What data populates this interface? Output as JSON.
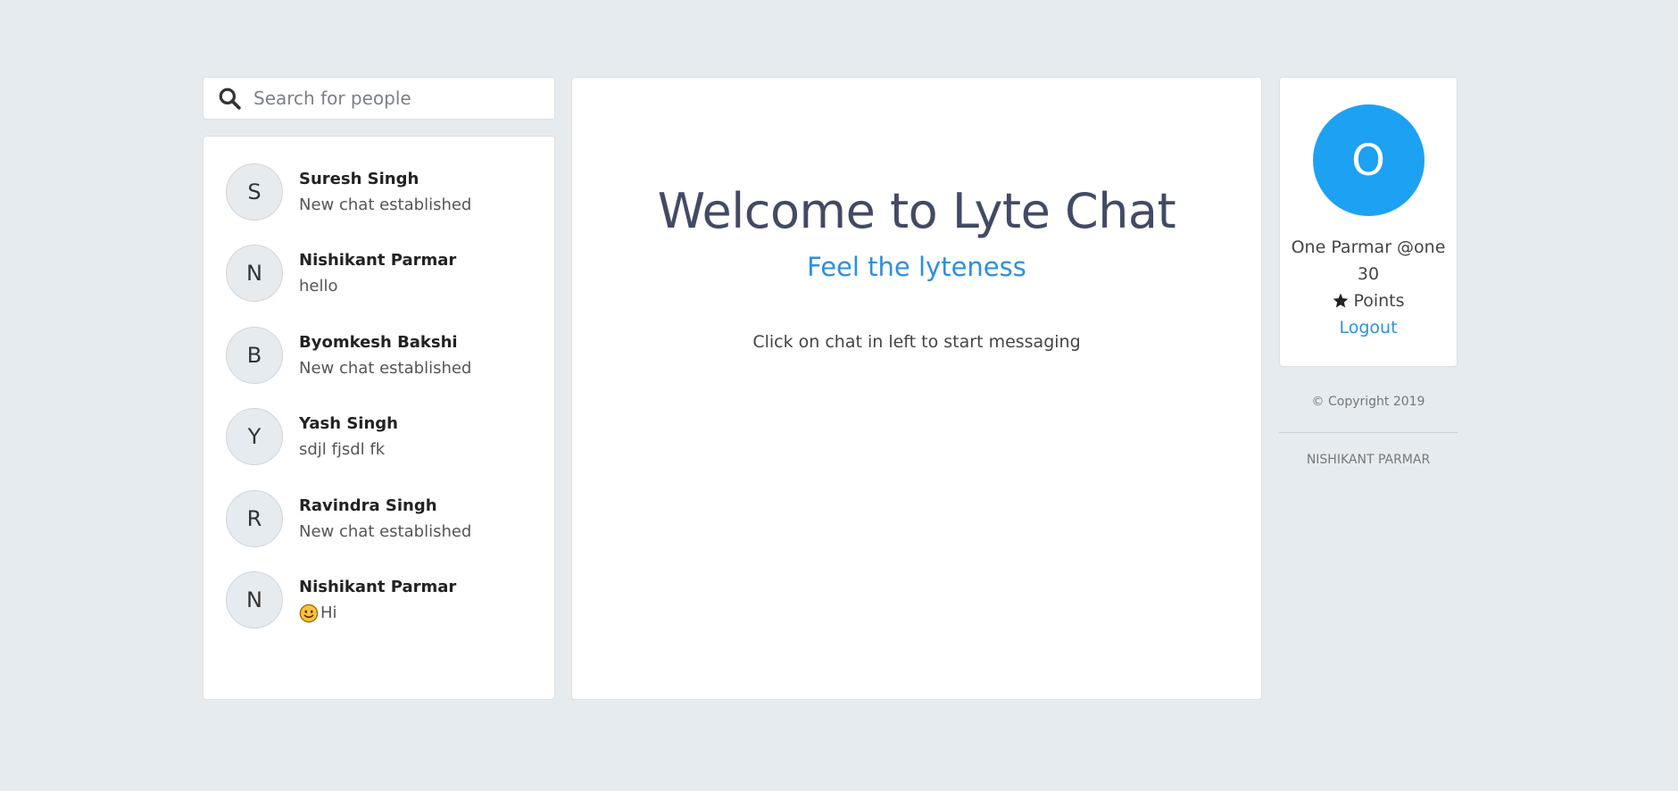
{
  "search": {
    "placeholder": "Search for people"
  },
  "chats": [
    {
      "initial": "S",
      "name": "Suresh Singh",
      "message": "New chat established",
      "emoji": false
    },
    {
      "initial": "N",
      "name": "Nishikant Parmar",
      "message": "hello",
      "emoji": false
    },
    {
      "initial": "B",
      "name": "Byomkesh Bakshi",
      "message": "New chat established",
      "emoji": false
    },
    {
      "initial": "Y",
      "name": "Yash Singh",
      "message": "sdjl fjsdl fk",
      "emoji": false
    },
    {
      "initial": "R",
      "name": "Ravindra Singh",
      "message": "New chat established",
      "emoji": false
    },
    {
      "initial": "N",
      "name": "Nishikant Parmar",
      "message": "Hi",
      "emoji": true
    }
  ],
  "main": {
    "title": "Welcome to Lyte Chat",
    "subtitle": "Feel the lyteness",
    "hint": "Click on chat in left to start messaging"
  },
  "profile": {
    "initial": "O",
    "name_line": "One Parmar @one",
    "points_value": "30",
    "points_label": "Points",
    "logout_label": "Logout"
  },
  "footer": {
    "copyright": "© Copyright 2019",
    "author": "NISHIKANT PARMAR"
  },
  "colors": {
    "background": "#e6ebef",
    "accent": "#1da1f2",
    "link": "#2d8fe0",
    "title": "#424a64"
  }
}
